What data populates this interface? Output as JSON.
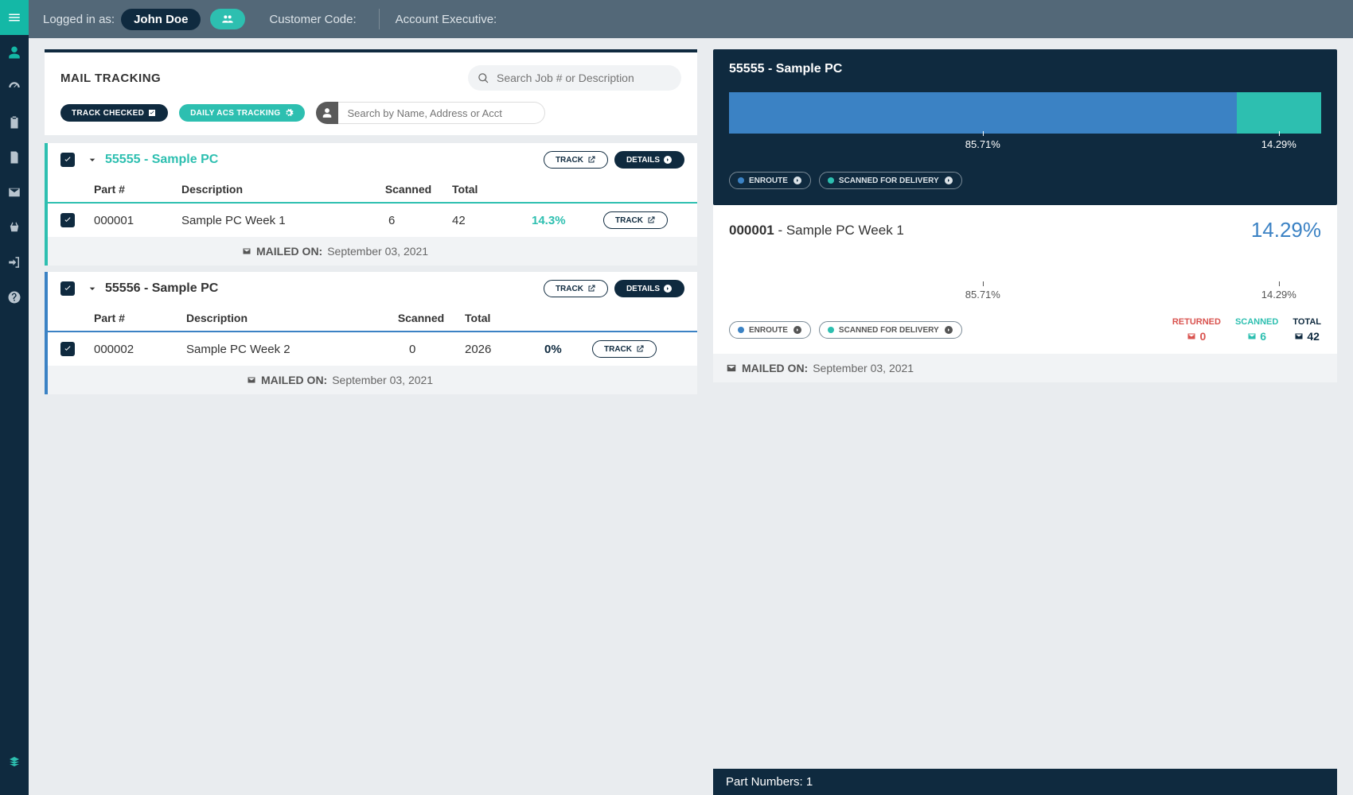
{
  "topbar": {
    "logged_in_label": "Logged in as:",
    "user_name": "John Doe",
    "customer_code_label": "Customer Code:",
    "account_exec_label": "Account Executive:"
  },
  "left": {
    "title": "MAIL TRACKING",
    "search_placeholder": "Search Job # or Description",
    "track_checked_btn": "TRACK CHECKED",
    "daily_acs_btn": "DAILY ACS TRACKING",
    "name_search_placeholder": "Search by Name, Address or Acct",
    "headers": {
      "part": "Part #",
      "desc": "Description",
      "scanned": "Scanned",
      "total": "Total"
    },
    "buttons": {
      "track": "TRACK",
      "details": "DETAILS"
    },
    "mailed_label": "MAILED ON:",
    "jobs": [
      {
        "id": "55555",
        "name": "Sample PC",
        "full": "55555 - Sample PC",
        "color": "teal",
        "rows": [
          {
            "part": "000001",
            "desc": "Sample PC Week 1",
            "scanned": "6",
            "total": "42",
            "pct": "14.3%",
            "pct_color": "teal"
          }
        ],
        "mailed_date": "September 03, 2021"
      },
      {
        "id": "55556",
        "name": "Sample PC",
        "full": "55556 - Sample PC",
        "color": "blue",
        "rows": [
          {
            "part": "000002",
            "desc": "Sample PC Week 2",
            "scanned": "0",
            "total": "2026",
            "pct": "0%",
            "pct_color": "navy"
          }
        ],
        "mailed_date": "September 03, 2021"
      }
    ]
  },
  "right": {
    "header_title": "55555 - Sample PC",
    "legend_enroute": "ENROUTE",
    "legend_scanned": "SCANNED FOR DELIVERY",
    "tick1": "85.71%",
    "tick2": "14.29%",
    "sub_part": "000001",
    "sub_desc": "Sample PC Week 1",
    "sub_pct": "14.29%",
    "stats": {
      "returned_label": "RETURNED",
      "scanned_label": "SCANNED",
      "total_label": "TOTAL",
      "returned_val": "0",
      "scanned_val": "6",
      "total_val": "42"
    },
    "mailed_label": "MAILED ON:",
    "mailed_date": "September 03, 2021",
    "footer": "Part Numbers: 1"
  },
  "chart_data": [
    {
      "type": "bar",
      "title": "55555 - Sample PC",
      "orientation": "horizontal-stacked",
      "series": [
        {
          "name": "ENROUTE",
          "values": [
            85.71
          ],
          "color": "#3b82c4"
        },
        {
          "name": "SCANNED FOR DELIVERY",
          "values": [
            14.29
          ],
          "color": "#2dbfb0"
        }
      ],
      "categories": [
        ""
      ],
      "xlabel": "",
      "ylabel": "",
      "xlim": [
        0,
        100
      ]
    },
    {
      "type": "bar",
      "title": "000001 - Sample PC Week 1",
      "orientation": "horizontal-stacked",
      "series": [
        {
          "name": "ENROUTE",
          "values": [
            85.71
          ],
          "color": "#3b82c4"
        },
        {
          "name": "SCANNED FOR DELIVERY",
          "values": [
            14.29
          ],
          "color": "#2dbfb0"
        }
      ],
      "categories": [
        ""
      ],
      "xlabel": "",
      "ylabel": "",
      "xlim": [
        0,
        100
      ]
    }
  ]
}
